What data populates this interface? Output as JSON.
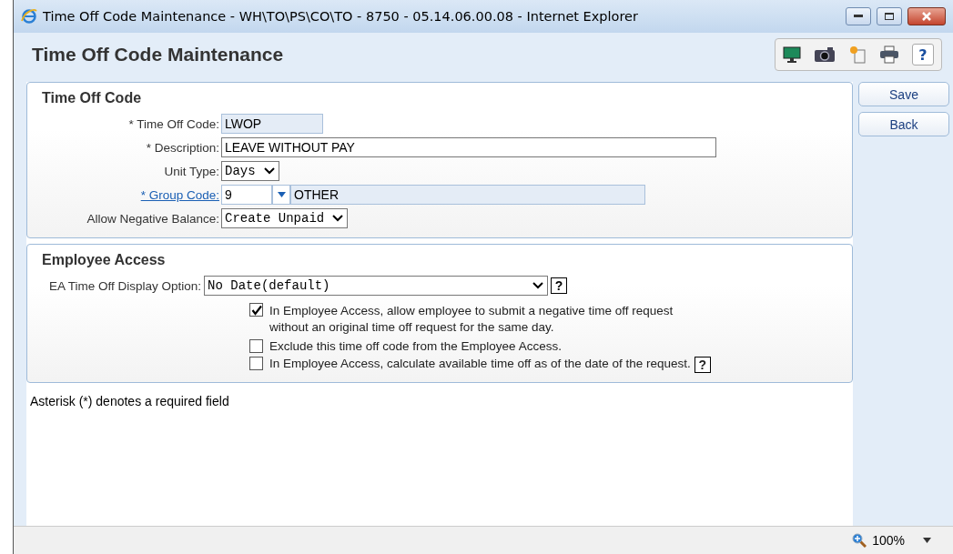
{
  "window": {
    "title": "Time Off Code Maintenance - WH\\TO\\PS\\CO\\TO - 8750 - 05.14.06.00.08 - Internet Explorer"
  },
  "page": {
    "title": "Time Off Code Maintenance",
    "help_label": "?"
  },
  "time_off_code": {
    "heading": "Time Off Code",
    "fields": [
      {
        "kind": "readonly",
        "label": "* Time Off Code:",
        "value": "LWOP"
      },
      {
        "kind": "text",
        "label": "* Description:",
        "value": "LEAVE WITHOUT PAY"
      },
      {
        "kind": "select",
        "label": "Unit Type:",
        "value": "Days"
      },
      {
        "kind": "lookup",
        "label": "* Group Code:",
        "value": "9",
        "description": "OTHER"
      },
      {
        "kind": "select",
        "label": "Allow Negative Balance:",
        "value": "Create Unpaid"
      }
    ]
  },
  "employee_access": {
    "heading": "Employee Access",
    "display_option": {
      "label": "EA Time Off Display Option:",
      "value": "No Date(default)",
      "help": "?"
    },
    "options": [
      {
        "label": "In Employee Access, allow employee to submit a negative time off request without an original time off request for the same day.",
        "checked": true
      },
      {
        "label": "Exclude this time off code from the Employee Access.",
        "checked": false
      },
      {
        "label": "In Employee Access, calculate available time off as of the date of the request.",
        "checked": false,
        "help": "?"
      }
    ]
  },
  "footnote": "Asterisk (*) denotes a required field",
  "buttons": [
    "Save",
    "Back"
  ],
  "status_bar": {
    "zoom": "100%"
  }
}
